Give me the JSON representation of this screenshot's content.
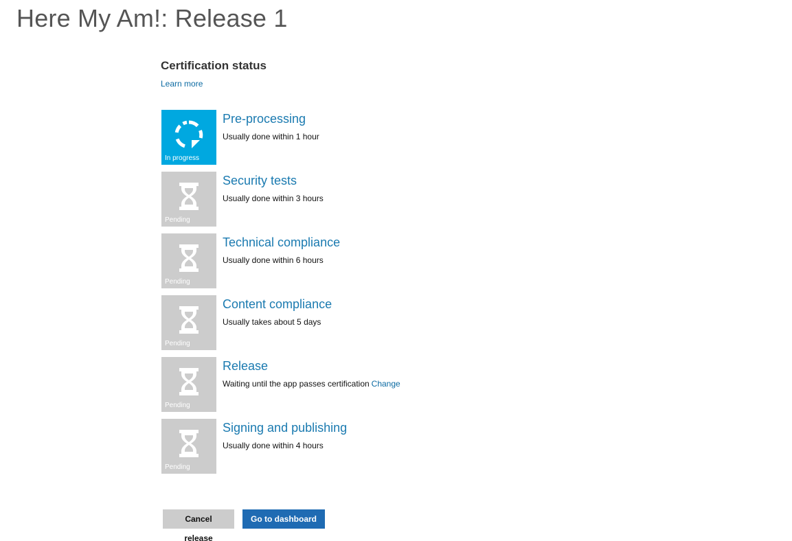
{
  "header": {
    "title": "Here My Am!: Release 1"
  },
  "certification": {
    "title": "Certification status",
    "learn_more": "Learn more"
  },
  "steps": [
    {
      "name": "Pre-processing",
      "description": "Usually done within 1 hour",
      "status": "In progress",
      "icon": "refresh-icon",
      "color": "#00a8e0"
    },
    {
      "name": "Security tests",
      "description": "Usually done within 3 hours",
      "status": "Pending",
      "icon": "hourglass-icon",
      "color": "#cccccc"
    },
    {
      "name": "Technical compliance",
      "description": "Usually done within 6 hours",
      "status": "Pending",
      "icon": "hourglass-icon",
      "color": "#cccccc"
    },
    {
      "name": "Content compliance",
      "description": "Usually takes about 5 days",
      "status": "Pending",
      "icon": "hourglass-icon",
      "color": "#cccccc"
    },
    {
      "name": "Release",
      "description": "Waiting until the app passes certification",
      "link": "Change",
      "status": "Pending",
      "icon": "hourglass-icon",
      "color": "#cccccc"
    },
    {
      "name": "Signing and publishing",
      "description": "Usually done within 4 hours",
      "status": "Pending",
      "icon": "hourglass-icon",
      "color": "#cccccc"
    }
  ],
  "actions": {
    "cancel_label": "Cancel release",
    "dashboard_label": "Go to dashboard"
  },
  "colors": {
    "accent_link": "#1a7ab0",
    "in_progress": "#00a8e0",
    "pending": "#cccccc",
    "primary_button": "#1f6bb3"
  }
}
